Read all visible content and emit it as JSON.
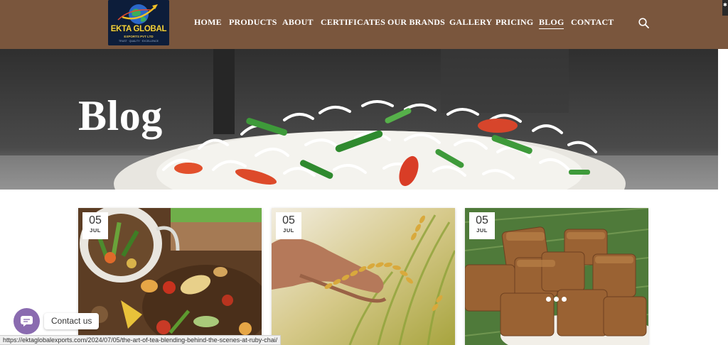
{
  "header": {
    "logo": {
      "name": "EKTA GLOBAL",
      "sub": "EXPORTS PVT LTD",
      "tagline": "TRUST · QUALITY · EXCELLENCE"
    },
    "nav": [
      "HOME",
      "PRODUCTS",
      "ABOUT",
      "CERTIFICATES",
      "OUR BRANDS",
      "GALLERY",
      "PRICING",
      "BLOG",
      "CONTACT"
    ],
    "active_nav": "BLOG",
    "icons": {
      "search": "search-icon"
    }
  },
  "hero": {
    "title": "Blog"
  },
  "posts": [
    {
      "day": "05",
      "month": "JUL",
      "image": "compost-bin-image"
    },
    {
      "day": "05",
      "month": "JUL",
      "image": "rice-paddy-hand-image"
    },
    {
      "day": "05",
      "month": "JUL",
      "image": "jaggery-cubes-image"
    }
  ],
  "contact_widget": {
    "label": "Contact us",
    "icon": "chat-bubble-icon"
  },
  "status_bar": {
    "url": "https://ektaglobalexports.com/2024/07/05/the-art-of-tea-blending-behind-the-scenes-at-ruby-chai/"
  },
  "colors": {
    "header_bg": "#7a563d",
    "hero_bg": "#3b3b3b",
    "contact_accent": "#8a6bb0"
  }
}
